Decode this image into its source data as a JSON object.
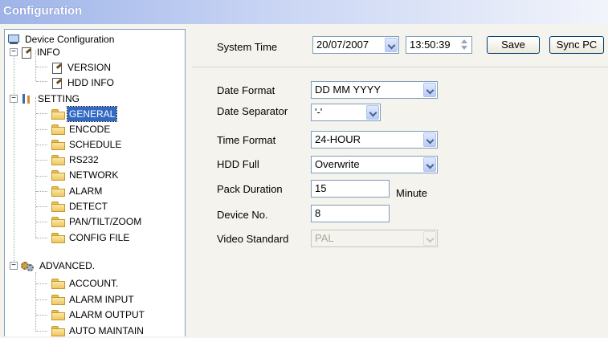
{
  "window": {
    "title": "Configuration"
  },
  "tree": {
    "root": "Device Configuration",
    "info": {
      "label": "INFO",
      "children": [
        "VERSION",
        "HDD INFO"
      ]
    },
    "setting": {
      "label": "SETTING",
      "children": [
        "GENERAL",
        "ENCODE",
        "SCHEDULE",
        "RS232",
        "NETWORK",
        "ALARM",
        "DETECT",
        "PAN/TILT/ZOOM",
        "CONFIG FILE"
      ]
    },
    "advanced": {
      "label": "ADVANCED.",
      "children": [
        "ACCOUNT.",
        "ALARM INPUT",
        "ALARM OUTPUT",
        "AUTO MAINTAIN"
      ]
    },
    "selected": "GENERAL"
  },
  "general": {
    "system_time_label": "System Time",
    "date_value": "20/07/2007",
    "time_value": "13:50:39",
    "save_label": "Save",
    "sync_label": "Sync PC",
    "date_format_label": "Date Format",
    "date_format_value": "DD MM YYYY",
    "date_separator_label": "Date Separator",
    "date_separator_value": "'-'",
    "time_format_label": "Time Format",
    "time_format_value": "24-HOUR",
    "hdd_full_label": "HDD Full",
    "hdd_full_value": "Overwrite",
    "pack_duration_label": "Pack Duration",
    "pack_duration_value": "15",
    "pack_duration_unit": "Minute",
    "device_no_label": "Device No.",
    "device_no_value": "8",
    "video_standard_label": "Video Standard",
    "video_standard_value": "PAL"
  }
}
